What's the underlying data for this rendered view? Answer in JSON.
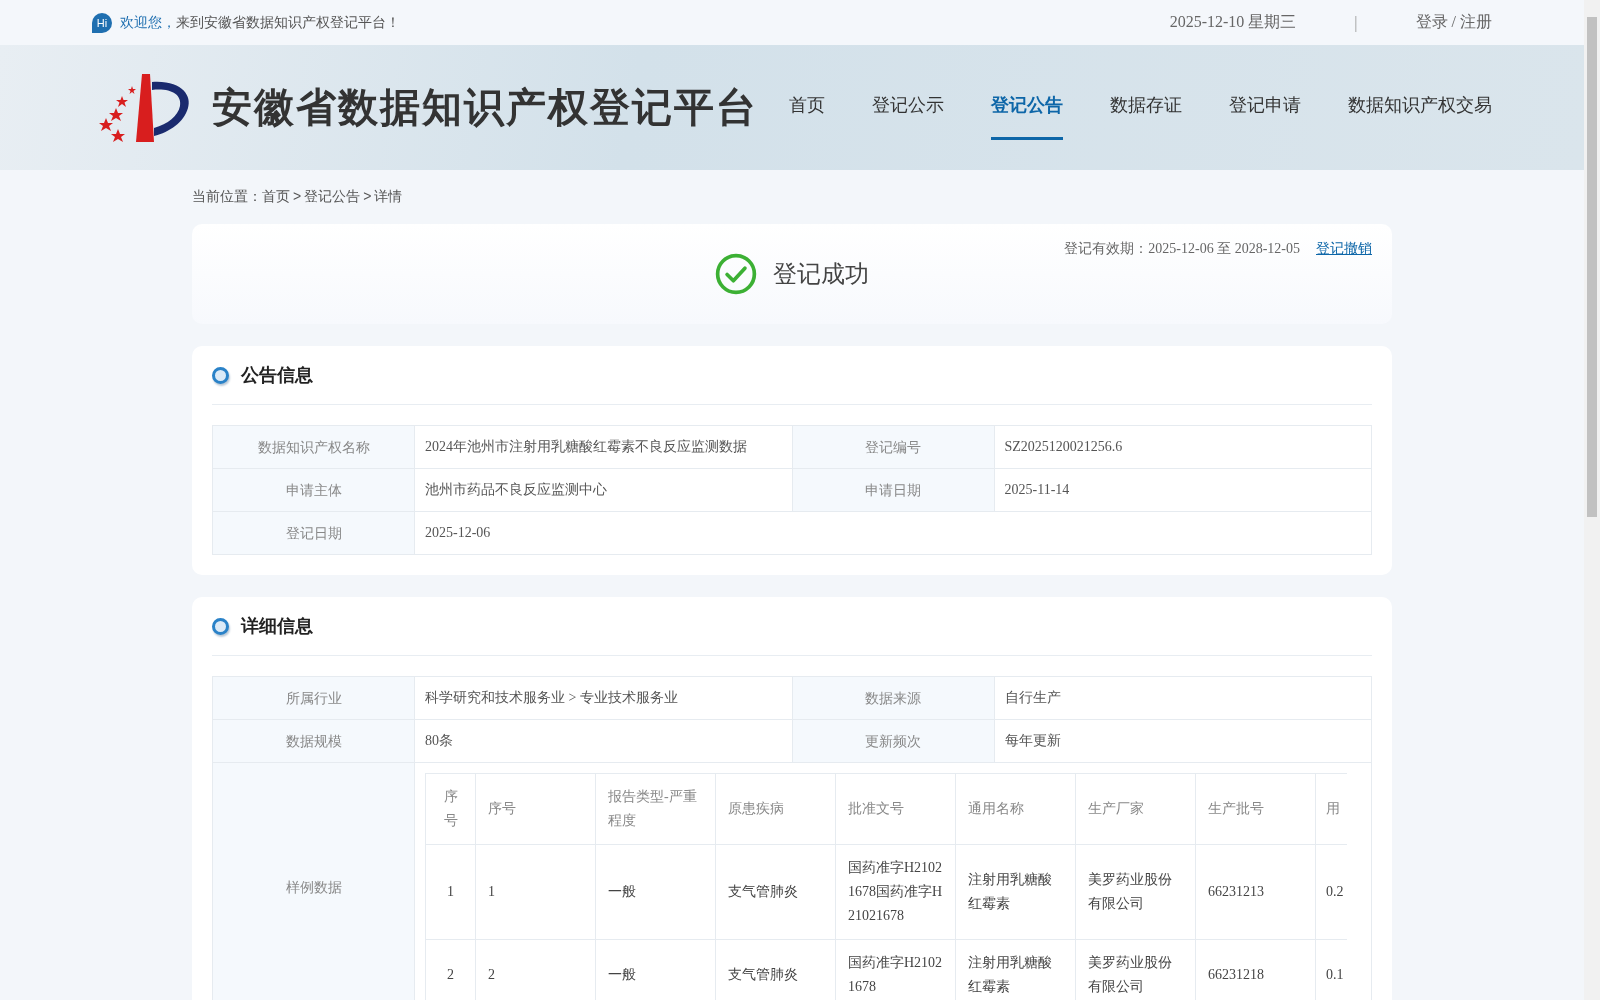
{
  "top_bar": {
    "hi_badge": "Hi",
    "greeting": "欢迎您，",
    "welcome": "来到安徽省数据知识产权登记平台！",
    "date": "2025-12-10 星期三",
    "separator": "|",
    "auth": "登录 / 注册"
  },
  "header": {
    "site_title": "安徽省数据知识产权登记平台",
    "nav": [
      {
        "label": "首页",
        "selected": false
      },
      {
        "label": "登记公示",
        "selected": false
      },
      {
        "label": "登记公告",
        "selected": true
      },
      {
        "label": "数据存证",
        "selected": false
      },
      {
        "label": "登记申请",
        "selected": false
      },
      {
        "label": "数据知识产权交易",
        "selected": false
      }
    ]
  },
  "breadcrumb": {
    "label": "当前位置：",
    "separator": ">",
    "items": [
      "首页",
      "登记公告",
      "详情"
    ]
  },
  "status_card": {
    "title": "登记成功",
    "validity": "登记有效期：2025-12-06 至 2028-12-05",
    "revoke_link": "登记撤销"
  },
  "sections": [
    {
      "title": "公告信息",
      "rows": [
        {
          "kind": "pairs",
          "cells": [
            {
              "label": "数据知识产权名称",
              "value": "2024年池州市注射用乳糖酸红霉素不良反应监测数据"
            },
            {
              "label": "登记编号",
              "value": "SZ2025120021256.6"
            }
          ]
        },
        {
          "kind": "pairs",
          "cells": [
            {
              "label": "申请主体",
              "value": "池州市药品不良反应监测中心"
            },
            {
              "label": "申请日期",
              "value": "2025-11-14"
            }
          ]
        },
        {
          "kind": "pairs",
          "cells": [
            {
              "label": "登记日期",
              "value": "2025-12-06"
            }
          ]
        }
      ]
    },
    {
      "title": "详细信息",
      "rows": [
        {
          "kind": "pairs",
          "cells": [
            {
              "label": "所属行业",
              "value": "科学研究和技术服务业 > 专业技术服务业"
            },
            {
              "label": "数据来源",
              "value": "自行生产"
            }
          ]
        },
        {
          "kind": "pairs",
          "cells": [
            {
              "label": "数据规模",
              "value": "80条"
            },
            {
              "label": "更新频次",
              "value": "每年更新"
            }
          ]
        },
        {
          "kind": "table",
          "label": "样例数据",
          "table": {
            "columns": [
              "序号",
              "序号",
              "报告类型-严重程度",
              "原患疾病",
              "批准文号",
              "通用名称",
              "生产厂家",
              "生产批号",
              "用"
            ],
            "rows": [
              [
                "1",
                "1",
                "一般",
                "支气管肺炎",
                "国药准字H21021678国药准字H21021678",
                "注射用乳糖酸红霉素",
                "美罗药业股份有限公司",
                "66231213",
                "0.2"
              ],
              [
                "2",
                "2",
                "一般",
                "支气管肺炎",
                "国药准字H21021678",
                "注射用乳糖酸红霉素",
                "美罗药业股份有限公司",
                "66231218",
                "0.1"
              ]
            ]
          }
        }
      ]
    }
  ]
}
